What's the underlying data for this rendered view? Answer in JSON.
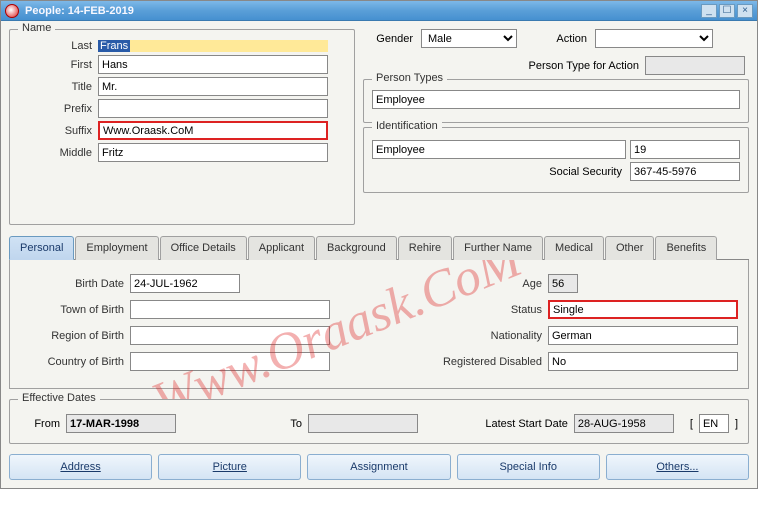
{
  "window": {
    "title": "People: 14-FEB-2019"
  },
  "name": {
    "legend": "Name",
    "last_label": "Last",
    "last_value": "Frans",
    "first_label": "First",
    "first_value": "Hans",
    "title_label": "Title",
    "title_value": "Mr.",
    "prefix_label": "Prefix",
    "prefix_value": "",
    "suffix_label": "Suffix",
    "suffix_value": "Www.Oraask.CoM",
    "middle_label": "Middle",
    "middle_value": "Fritz"
  },
  "top_right": {
    "gender_label": "Gender",
    "gender_value": "Male",
    "action_label": "Action",
    "action_value": "",
    "person_type_action_label": "Person Type for Action"
  },
  "person_types": {
    "legend": "Person Types",
    "value": "Employee"
  },
  "identification": {
    "legend": "Identification",
    "type_value": "Employee",
    "type_num": "19",
    "ssn_label": "Social Security",
    "ssn_value": "367-45-5976"
  },
  "tabs": {
    "items": [
      "Personal",
      "Employment",
      "Office Details",
      "Applicant",
      "Background",
      "Rehire",
      "Further Name",
      "Medical",
      "Other",
      "Benefits"
    ]
  },
  "personal": {
    "birth_date_label": "Birth Date",
    "birth_date": "24-JUL-1962",
    "town_label": "Town of Birth",
    "town": "",
    "region_label": "Region of Birth",
    "region": "",
    "country_label": "Country of Birth",
    "country": "",
    "age_label": "Age",
    "age": "56",
    "status_label": "Status",
    "status": "Single",
    "nationality_label": "Nationality",
    "nationality": "German",
    "disabled_label": "Registered Disabled",
    "disabled": "No"
  },
  "effective": {
    "legend": "Effective Dates",
    "from_label": "From",
    "from": "17-MAR-1998",
    "to_label": "To",
    "to": "",
    "latest_label": "Latest Start Date",
    "latest": "28-AUG-1958",
    "bracket_open": "[",
    "bracket_value": "EN",
    "bracket_close": "]"
  },
  "buttons": {
    "address": "Address",
    "picture": "Picture",
    "assignment": "Assignment",
    "special": "Special Info",
    "others": "Others..."
  },
  "watermark": "Www.Oraask.CoM"
}
